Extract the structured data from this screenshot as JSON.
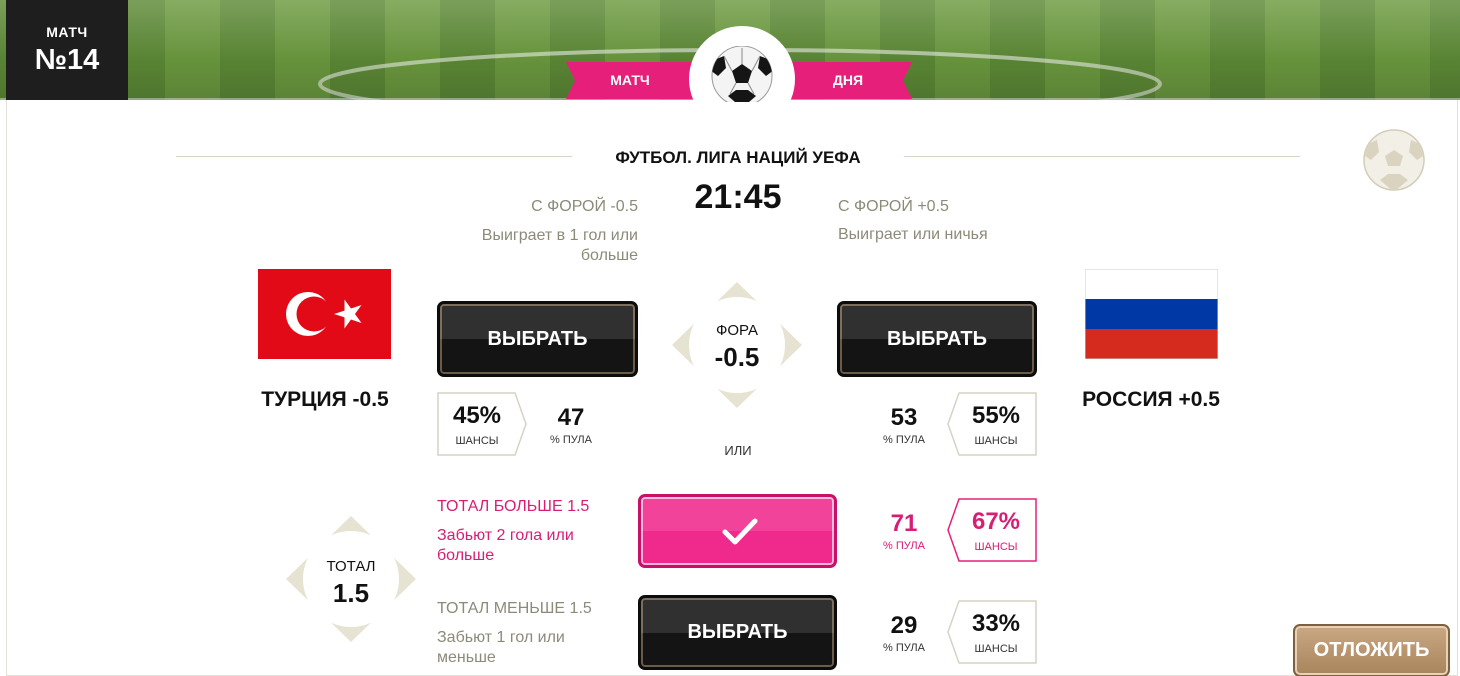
{
  "header": {
    "match_label": "МАТЧ",
    "match_number": "№14",
    "ribbon_left": "МАТЧ",
    "ribbon_right": "ДНЯ"
  },
  "event": {
    "league": "ФУТБОЛ. ЛИГА НАЦИЙ УЕФА",
    "time": "21:45"
  },
  "handicap": {
    "diamond_label": "ФОРА",
    "diamond_value": "-0.5",
    "or_label": "ИЛИ",
    "left": {
      "title": "С ФОРОЙ -0.5",
      "desc_1": "Выиграет в 1 гол или",
      "desc_2": "больше",
      "team": "ТУРЦИЯ -0.5",
      "button": "ВЫБРАТЬ",
      "chance": "45%",
      "chance_label": "ШАНСЫ",
      "pool": "47",
      "pool_label": "% ПУЛА"
    },
    "right": {
      "title": "С ФОРОЙ +0.5",
      "desc_1": "Выиграет или ничья",
      "team": "РОССИЯ +0.5",
      "button": "ВЫБРАТЬ",
      "chance": "55%",
      "chance_label": "ШАНСЫ",
      "pool": "53",
      "pool_label": "% ПУЛА"
    }
  },
  "total": {
    "diamond_label": "ТОТАЛ",
    "diamond_value": "1.5",
    "over": {
      "title": "ТОТАЛ БОЛЬШЕ 1.5",
      "desc_1": "Забьют 2 гола или",
      "desc_2": "больше",
      "selected": true,
      "pool": "71",
      "pool_label": "% ПУЛА",
      "chance": "67%",
      "chance_label": "ШАНСЫ"
    },
    "under": {
      "title": "ТОТАЛ МЕНЬШЕ 1.5",
      "desc_1": "Забьют 1 гол или",
      "desc_2": "меньше",
      "button": "ВЫБРАТЬ",
      "pool": "29",
      "pool_label": "% ПУЛА",
      "chance": "33%",
      "chance_label": "ШАНСЫ"
    }
  },
  "actions": {
    "postpone": "ОТЛОЖИТЬ"
  },
  "colors": {
    "accent_pink": "#e6207a",
    "muted_text": "#8c8a78",
    "button_dark": "#141414",
    "postpone_bg": "#b8936a"
  },
  "icons": [
    "soccer-ball-icon",
    "checkmark-icon",
    "turkey-flag-icon",
    "russia-flag-icon"
  ]
}
